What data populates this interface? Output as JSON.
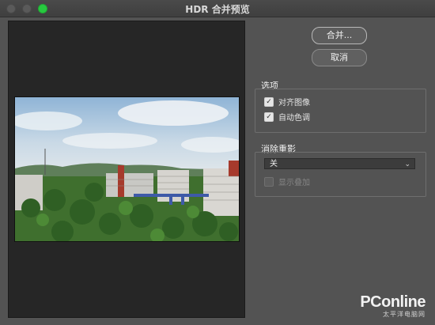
{
  "window": {
    "title": "HDR 合并预览"
  },
  "buttons": {
    "merge_label": "合并...",
    "cancel_label": "取消"
  },
  "options": {
    "label": "选项",
    "items": [
      {
        "label": "对齐图像",
        "checked": true
      },
      {
        "label": "自动色调",
        "checked": true
      }
    ]
  },
  "ghost": {
    "label": "消除重影",
    "select_value": "关",
    "overlay_label": "显示叠加",
    "overlay_checked": false
  },
  "watermark": {
    "main": "PConline",
    "sub": "太平洋电脑网"
  },
  "colors": {
    "zoom_button": "#27c93f",
    "panel_bg": "#535353",
    "preview_bg": "#262626"
  }
}
